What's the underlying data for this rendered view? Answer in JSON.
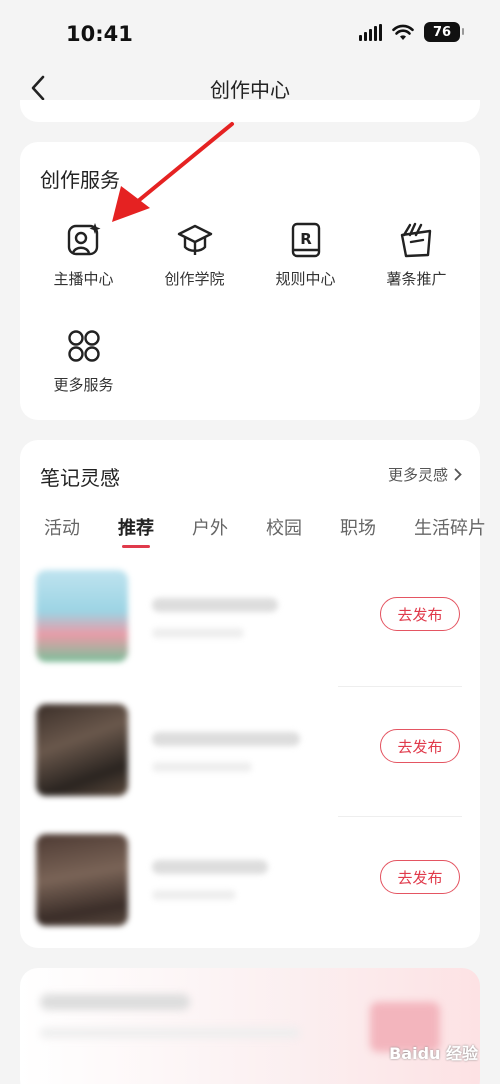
{
  "status_bar": {
    "time": "10:41",
    "battery": "76"
  },
  "nav": {
    "title": "创作中心"
  },
  "services": {
    "title": "创作服务",
    "items": [
      {
        "label": "主播中心",
        "icon": "host-center-icon"
      },
      {
        "label": "创作学院",
        "icon": "graduation-cap-icon"
      },
      {
        "label": "规则中心",
        "icon": "rules-book-icon"
      },
      {
        "label": "薯条推广",
        "icon": "fries-promo-icon"
      },
      {
        "label": "更多服务",
        "icon": "more-services-icon"
      }
    ]
  },
  "inspiration": {
    "title": "笔记灵感",
    "more_label": "更多灵感",
    "tabs": [
      "活动",
      "推荐",
      "户外",
      "校园",
      "职场",
      "生活碎片"
    ],
    "active_tab": "推荐",
    "items": [
      {
        "publish_label": "去发布"
      },
      {
        "publish_label": "去发布"
      },
      {
        "publish_label": "去发布"
      }
    ]
  },
  "colors": {
    "accent": "#e03a4b",
    "annotation_arrow": "#e52222"
  },
  "watermark": "Baidu 经验"
}
